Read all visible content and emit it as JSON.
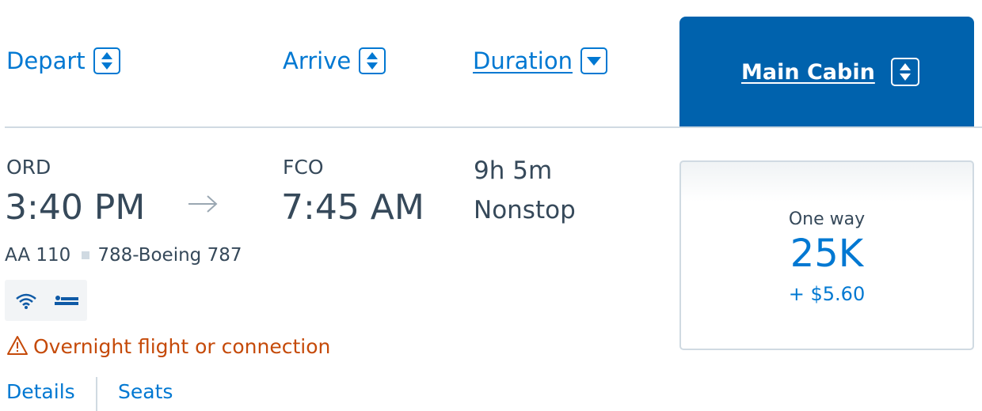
{
  "header": {
    "depart_label": "Depart",
    "arrive_label": "Arrive",
    "duration_label": "Duration",
    "cabin_label": "Main Cabin"
  },
  "flight": {
    "origin_code": "ORD",
    "depart_time": "3:40 PM",
    "destination_code": "FCO",
    "arrive_time": "7:45 AM",
    "duration": "9h 5m",
    "stops": "Nonstop",
    "flight_number": "AA 110",
    "aircraft": "788-Boeing 787",
    "amenities": [
      "wifi-icon",
      "lie-flat-seat-icon"
    ],
    "warning": "Overnight flight or connection",
    "links": {
      "details": "Details",
      "seats": "Seats"
    }
  },
  "fare": {
    "trip_type": "One way",
    "miles": "25K",
    "fees": "+ $5.60"
  },
  "colors": {
    "accent_blue": "#0078d2",
    "cabin_blue": "#0062ad",
    "text_dark": "#36495a",
    "warning_orange": "#c54a09",
    "divider_gray": "#d0dae2"
  }
}
